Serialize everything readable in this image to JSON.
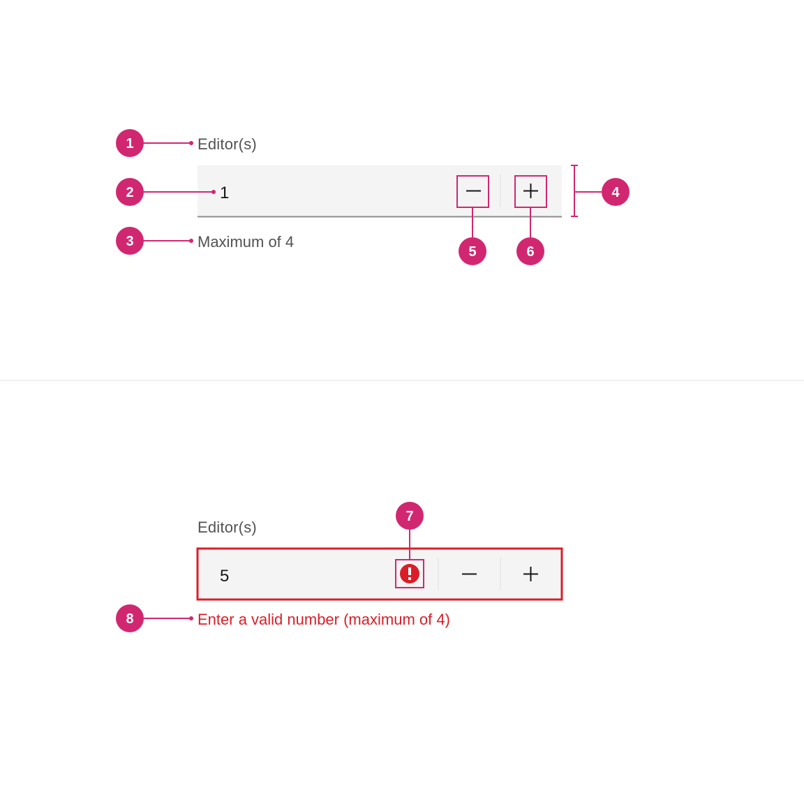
{
  "colors": {
    "accent": "#d12771",
    "error": "#da1e28",
    "gray10": "#f4f4f4",
    "gray50": "#8d8d8d",
    "gray70": "#525252",
    "text": "#161616",
    "divider": "#e0e0e0",
    "stroke": "#a8a8a8"
  },
  "annotations": [
    "1",
    "2",
    "3",
    "4",
    "5",
    "6",
    "7",
    "8"
  ],
  "stepper_normal": {
    "label": "Editor(s)",
    "value": "1",
    "helper": "Maximum of 4",
    "buttons": {
      "dec": "−",
      "inc": "+"
    }
  },
  "stepper_error": {
    "label": "Editor(s)",
    "value": "5",
    "error": "Enter a valid number (maximum of 4)",
    "buttons": {
      "dec": "−",
      "inc": "+"
    },
    "icon": "warning-filled-icon"
  }
}
